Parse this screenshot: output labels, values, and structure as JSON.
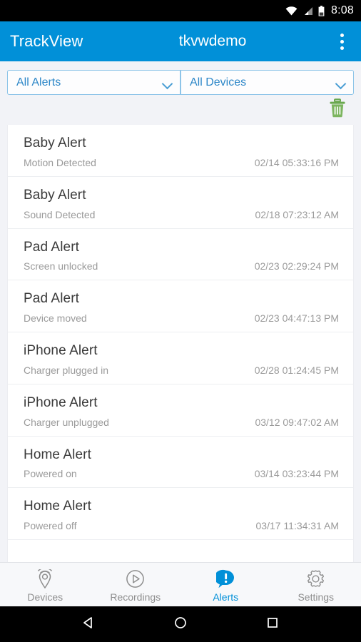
{
  "status_bar": {
    "time": "8:08",
    "icons": [
      "wifi-icon",
      "cell-signal-icon",
      "battery-icon"
    ]
  },
  "app_bar": {
    "title": "TrackView",
    "account": "tkvwdemo",
    "overflow_label": "overflow-menu"
  },
  "filters": {
    "alert_filter": {
      "value": "All Alerts",
      "icon": "chevron-down-icon"
    },
    "device_filter": {
      "value": "All Devices",
      "icon": "chevron-down-icon"
    },
    "delete_all": {
      "icon": "trash-icon",
      "color": "#6aa84f"
    }
  },
  "alerts": [
    {
      "title": "Baby Alert",
      "desc": "Motion Detected",
      "time": "02/14 05:33:16 PM"
    },
    {
      "title": "Baby Alert",
      "desc": "Sound Detected",
      "time": "02/18 07:23:12 AM"
    },
    {
      "title": "Pad Alert",
      "desc": "Screen unlocked",
      "time": "02/23 02:29:24 PM"
    },
    {
      "title": "Pad Alert",
      "desc": "Device moved",
      "time": "02/23 04:47:13 PM"
    },
    {
      "title": "iPhone Alert",
      "desc": "Charger plugged in",
      "time": "02/28 01:24:45 PM"
    },
    {
      "title": "iPhone Alert",
      "desc": "Charger unplugged",
      "time": "03/12 09:47:02 AM"
    },
    {
      "title": "Home Alert",
      "desc": "Powered on",
      "time": "03/14 03:23:44 PM"
    },
    {
      "title": "Home Alert",
      "desc": "Powered off",
      "time": "03/17 11:34:31 AM"
    }
  ],
  "tabs": [
    {
      "label": "Devices",
      "icon": "location-pin-icon",
      "active": false
    },
    {
      "label": "Recordings",
      "icon": "play-circle-icon",
      "active": false
    },
    {
      "label": "Alerts",
      "icon": "alert-bubble-icon",
      "active": true
    },
    {
      "label": "Settings",
      "icon": "gear-icon",
      "active": false
    }
  ],
  "nav_bar": {
    "back": "back-triangle-icon",
    "home": "home-circle-icon",
    "recents": "recents-square-icon"
  },
  "colors": {
    "accent": "#0190d8",
    "trash_green": "#6aa84f",
    "page_bg": "#f2f3f7"
  }
}
